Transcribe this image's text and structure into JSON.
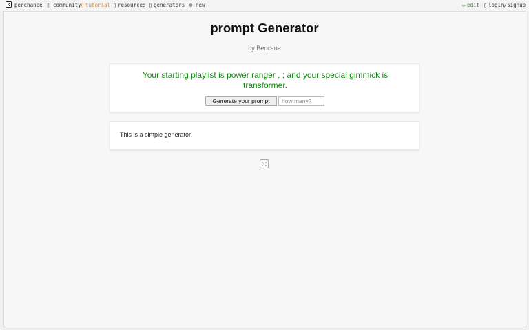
{
  "nav": {
    "site": "perchance",
    "community": "community",
    "tutorial": "tutorial",
    "resources": "resources",
    "generators": "generators",
    "new": "new",
    "edit": "edit",
    "login": "login/signup",
    "icons": {
      "site": "dice-icon",
      "community": "community-icon",
      "tutorial": "tutorial-icon",
      "resources": "resources-icon",
      "generators": "generators-icon",
      "new": "plus-circle-icon",
      "edit": "pencil-icon",
      "login": "login-icon"
    },
    "active_color": "#e8862a",
    "edit_color": "#2f8a2f"
  },
  "page": {
    "title": "prompt Generator",
    "author_prefix": "by",
    "author": "Bencaua"
  },
  "output": {
    "text": "Your starting playlist is power ranger , ; and your special gimmick is transformer.",
    "color": "#108a10"
  },
  "controls": {
    "generate_label": "Generate your prompt",
    "count_placeholder": "how many?"
  },
  "description": {
    "text": "This is a simple generator."
  }
}
